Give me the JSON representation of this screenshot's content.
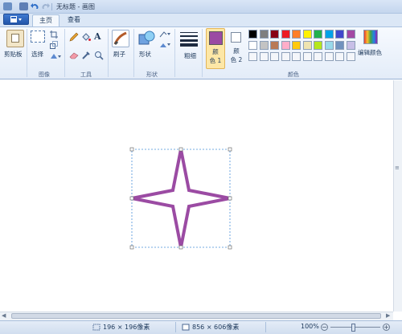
{
  "window": {
    "title": "无标题 - 画图"
  },
  "tabs": [
    {
      "label": "主页",
      "active": true
    },
    {
      "label": "查看",
      "active": false
    }
  ],
  "ribbon": {
    "clipboard": {
      "paste_label": "剪贴板",
      "group": ""
    },
    "image": {
      "select_label": "选择",
      "group": "图像"
    },
    "tools": {
      "group": "工具"
    },
    "brush": {
      "label": "刷子"
    },
    "shapes": {
      "label": "形状",
      "group": "形状"
    },
    "size": {
      "label": "粗细"
    },
    "color1": {
      "label_line1": "颜",
      "label_line2": "色 1",
      "value": "#9b4ba3"
    },
    "color2": {
      "label_line1": "颜",
      "label_line2": "色 2",
      "value": "#ffffff"
    },
    "edit_colors": {
      "label": "编辑颜色"
    },
    "colors_group": "颜色",
    "palette_row1": [
      "#000000",
      "#7f7f7f",
      "#880015",
      "#ed1c24",
      "#ff7f27",
      "#fff200",
      "#22b14c",
      "#00a2e8",
      "#3f48cc",
      "#a349a4"
    ],
    "palette_row2": [
      "#ffffff",
      "#c3c3c3",
      "#b97a57",
      "#ffaec9",
      "#ffc90e",
      "#efe4b0",
      "#b5e61d",
      "#99d9ea",
      "#7092be",
      "#c8bfe7"
    ]
  },
  "canvas": {
    "shape": "four-point-star",
    "stroke_color": "#9b4ba3"
  },
  "status": {
    "selection_size": "196 × 196像素",
    "canvas_size": "856 × 606像素",
    "zoom": "100%"
  },
  "icons": {
    "file_menu": "file-menu-icon",
    "save": "save-icon",
    "undo": "undo-icon",
    "redo": "redo-icon"
  }
}
